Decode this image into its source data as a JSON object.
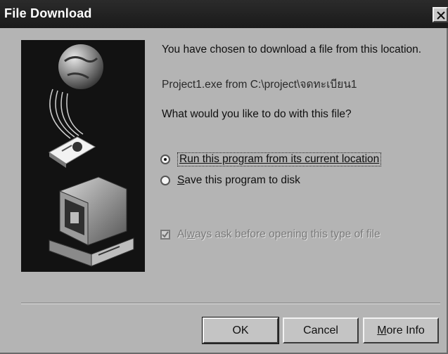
{
  "window": {
    "title": "File Download"
  },
  "message": {
    "chosen": "You have chosen to download a file from this location.",
    "path": "Project1.exe from C:\\project\\จดทะเบียน1",
    "question": "What would you like to do with this file?"
  },
  "options": {
    "run_label": "Run this program from its current location",
    "run_selected": true,
    "save_prefix": "S",
    "save_rest": "ave this program to disk",
    "save_selected": false
  },
  "always_ask": {
    "label_prefix": "Al",
    "label_u": "w",
    "label_rest": "ays ask before opening this type of file",
    "checked": true,
    "enabled": false
  },
  "buttons": {
    "ok": "OK",
    "cancel": "Cancel",
    "more_prefix": "M",
    "more_rest": "ore Info"
  },
  "icons": {
    "close": "close-icon",
    "illustration": "download-globe-computer-illustration"
  }
}
